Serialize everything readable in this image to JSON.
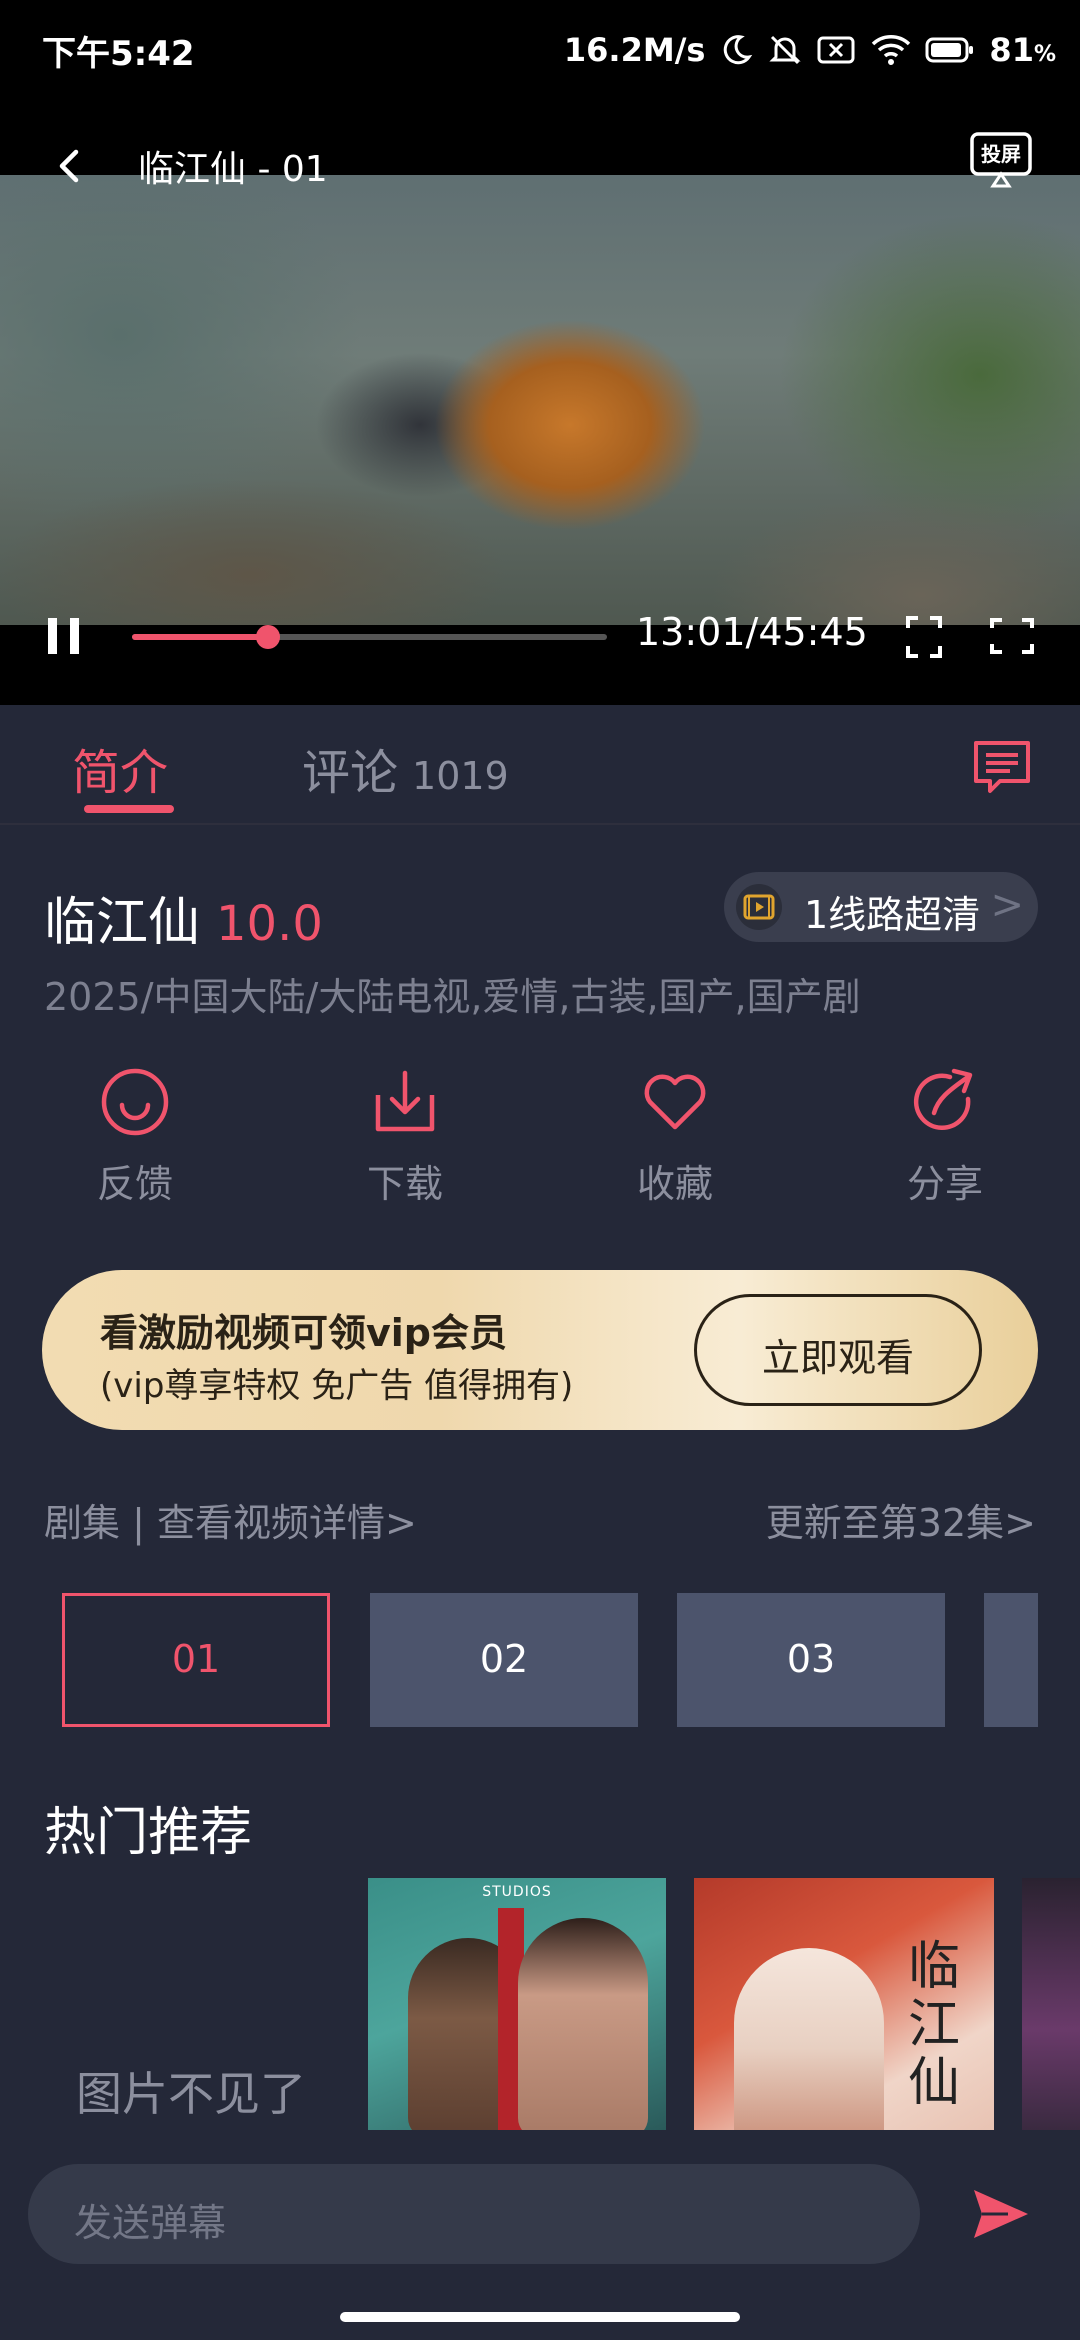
{
  "status_bar": {
    "time": "下午5:42",
    "speed": "16.2M/s",
    "battery": "81"
  },
  "player": {
    "title": "临江仙 - 01",
    "cast_label": "投屏",
    "progress": 0.286,
    "time_text": "13:01/45:45"
  },
  "tabs": {
    "intro": "简介",
    "comments": "评论",
    "comment_count": "1019"
  },
  "show": {
    "title": "临江仙",
    "score": "10.0",
    "line_label": "1线路超清",
    "line_chevron": ">",
    "meta": "2025/中国大陆/大陆电视,爱情,古装,国产,国产剧"
  },
  "actions": [
    {
      "label": "反馈",
      "icon": "smile-feedback-icon"
    },
    {
      "label": "下载",
      "icon": "download-icon"
    },
    {
      "label": "收藏",
      "icon": "heart-icon"
    },
    {
      "label": "分享",
      "icon": "share-icon"
    }
  ],
  "vip": {
    "title": "看激励视频可领vip会员",
    "subtitle": "(vip尊享特权 免广告 值得拥有)",
    "button": "立即观看"
  },
  "episodes": {
    "header_left": "剧集 | 查看视频详情>",
    "header_right": "更新至第32集>",
    "items": [
      "01",
      "02",
      "03"
    ],
    "active": "01"
  },
  "recommend": {
    "title": "热门推荐",
    "missing_image_text": "图片不见了",
    "poster1_studio": "STUDIOS",
    "poster2_calligraphy": "临江仙"
  },
  "danmu": {
    "placeholder": "发送弹幕"
  },
  "colors": {
    "accent": "#f0546c",
    "background": "#242838",
    "muted_text": "#8c8f9e",
    "episode_bg": "#4c546c"
  }
}
